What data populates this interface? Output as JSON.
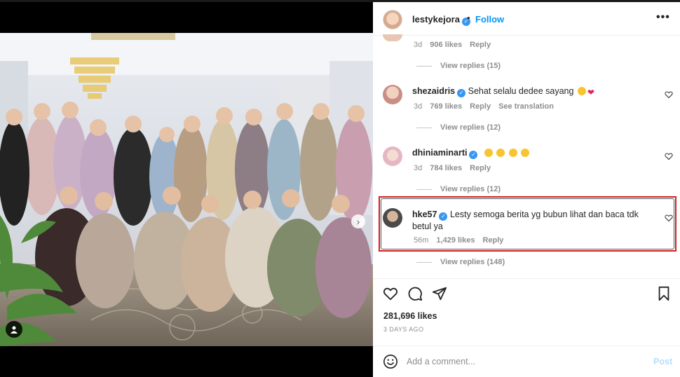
{
  "post": {
    "username": "lestykejora",
    "follow_label": "Follow",
    "dot": "•",
    "more_label": "•••",
    "likes": "281,696 likes",
    "time_ago": "3 DAYS AGO",
    "carousel_next": "›"
  },
  "comments": [
    {
      "meta": {
        "time": "3d",
        "likes": "906 likes",
        "reply": "Reply"
      },
      "view_replies": "View replies (15)"
    },
    {
      "username": "shezaidris",
      "text": "Sehat selalu dedee sayang",
      "emojis": [
        "smiling-face",
        "red-heart"
      ],
      "meta": {
        "time": "3d",
        "likes": "769 likes",
        "reply": "Reply",
        "translate": "See translation"
      },
      "view_replies": "View replies (12)"
    },
    {
      "username": "dhiniaminarti",
      "text": "",
      "emojis": [
        "smiling-face",
        "smiling-face",
        "smiling-face",
        "smiling-face"
      ],
      "meta": {
        "time": "3d",
        "likes": "784 likes",
        "reply": "Reply"
      },
      "view_replies": "View replies (12)"
    },
    {
      "username": "hke57",
      "text": "Lesty semoga berita yg bubun lihat dan baca tdk betul ya",
      "meta": {
        "time": "56m",
        "likes": "1,429 likes",
        "reply": "Reply"
      },
      "view_replies": "View replies (148)",
      "highlighted": true
    }
  ],
  "composer": {
    "placeholder": "Add a comment...",
    "post_label": "Post"
  },
  "colors": {
    "accent": "#0095f6",
    "verified": "#3897f0",
    "highlight": "#d21f1f",
    "muted": "#8e8e8e"
  },
  "icons": [
    "heart-icon",
    "comment-icon",
    "share-icon",
    "bookmark-icon",
    "emoji-icon",
    "user-tag-icon",
    "more-icon"
  ]
}
